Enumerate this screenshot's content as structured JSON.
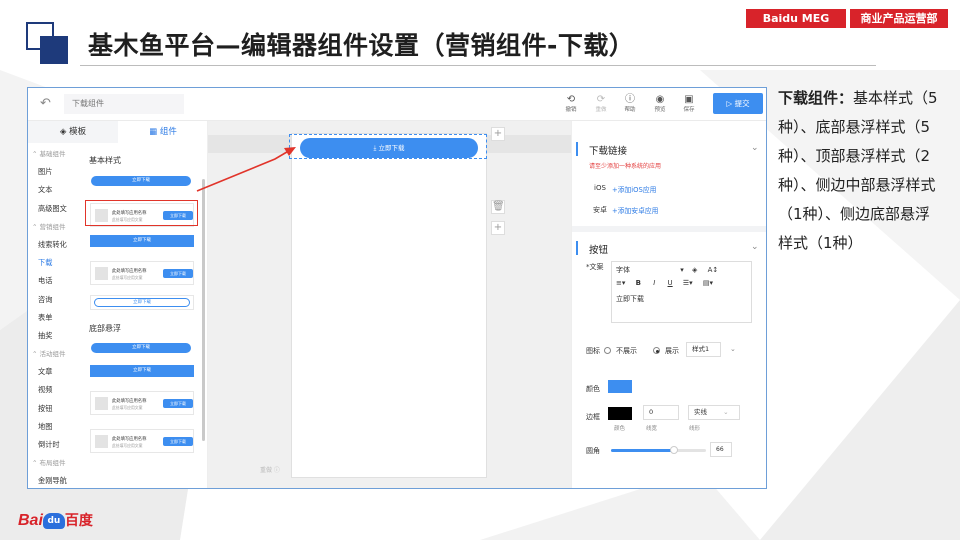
{
  "header": {
    "title": "基木鱼平台—编辑器组件设置（营销组件-下载）",
    "badge_left": "Baidu MEG",
    "badge_right": "商业产品运营部"
  },
  "editor": {
    "topbar": {
      "title_placeholder": "下载组件",
      "tools": [
        {
          "label": "撤销",
          "icon": "undo-icon"
        },
        {
          "label": "重做",
          "icon": "redo-icon"
        },
        {
          "label": "帮助",
          "icon": "help-icon"
        },
        {
          "label": "预览",
          "icon": "preview-icon"
        },
        {
          "label": "保存",
          "icon": "save-icon"
        }
      ],
      "submit_label": "提交"
    },
    "left_tabs": {
      "templates": "模板",
      "components": "组件"
    },
    "nav": [
      {
        "label": "基础组件",
        "group": true
      },
      {
        "label": "图片"
      },
      {
        "label": "文本"
      },
      {
        "label": "高级图文"
      },
      {
        "label": "营销组件",
        "group": true
      },
      {
        "label": "线索转化"
      },
      {
        "label": "下载",
        "active": true
      },
      {
        "label": "电话"
      },
      {
        "label": "咨询"
      },
      {
        "label": "表单"
      },
      {
        "label": "抽奖"
      },
      {
        "label": "活动组件",
        "group": true
      },
      {
        "label": "文章"
      },
      {
        "label": "视频"
      },
      {
        "label": "按钮"
      },
      {
        "label": "地图"
      },
      {
        "label": "倒计时"
      },
      {
        "label": "布局组件",
        "group": true
      },
      {
        "label": "金刚导航"
      }
    ],
    "components": {
      "section_basic": "基本样式",
      "section_bottom": "底部悬浮",
      "btn_text": "立即下载",
      "card_title": "此处填写应用名称",
      "card_sub": "此处填写应用文案"
    },
    "canvas": {
      "button_label": "立即下载",
      "hint": "重做 ⓘ"
    },
    "right": {
      "download_link_title": "下载链接",
      "download_hint": "请至少添加一种系统的应用",
      "ios_label": "iOS",
      "ios_add": "+添加iOS应用",
      "android_label": "安卓",
      "android_add": "+添加安卓应用",
      "button_title": "按钮",
      "copy_label": "文案",
      "font_label": "字体",
      "editor_text": "立即下载",
      "icon_label": "图标",
      "icon_hide": "不展示",
      "icon_show": "展示",
      "icon_style": "样式1",
      "color_label": "颜色",
      "border_label": "边框",
      "border_color_sub": "颜色",
      "border_width_value": "0",
      "border_width_sub": "线宽",
      "border_style_value": "实线",
      "border_style_sub": "线形",
      "radius_label": "圆角",
      "radius_value": "66",
      "radius_fraction": 0.66,
      "button_color": "#3d8ef0",
      "border_color": "#000000"
    }
  },
  "description": {
    "lead": "下载组件：",
    "body": "基本样式（5种）、底部悬浮样式（5种）、顶部悬浮样式（2种）、侧边中部悬浮样式（1种）、侧边底部悬浮样式（1种）"
  },
  "footer": {
    "logo_bai": "Bai",
    "logo_du": "du",
    "logo_cn": "百度"
  }
}
